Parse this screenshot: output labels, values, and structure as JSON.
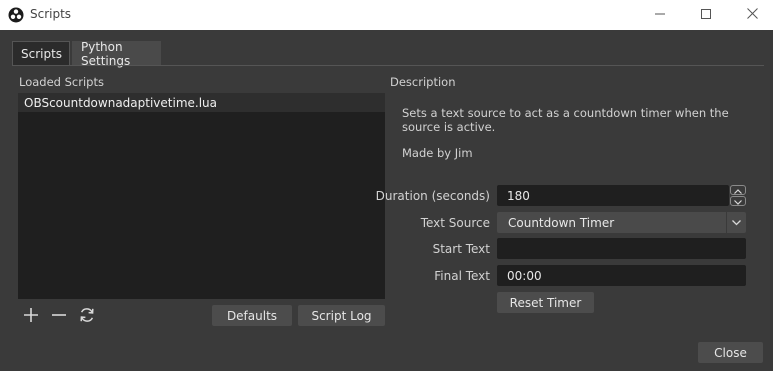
{
  "window": {
    "title": "Scripts",
    "app_icon": "obs-logo-icon"
  },
  "tabs": [
    {
      "label": "Scripts",
      "active": true
    },
    {
      "label": "Python Settings",
      "active": false
    }
  ],
  "loaded_scripts": {
    "label": "Loaded Scripts",
    "items": [
      "OBScountdownadaptivetime.lua"
    ],
    "toolbar_icons": [
      "plus-icon",
      "minus-icon",
      "refresh-icon"
    ],
    "defaults_label": "Defaults",
    "script_log_label": "Script Log"
  },
  "description": {
    "label": "Description",
    "text": "Sets a text source to act as a countdown timer when the source is active.",
    "author": "Made by Jim"
  },
  "settings": {
    "duration": {
      "label": "Duration (seconds)",
      "value": "180"
    },
    "text_source": {
      "label": "Text Source",
      "value": "Countdown Timer"
    },
    "start_text": {
      "label": "Start Text",
      "value": ""
    },
    "final_text": {
      "label": "Final Text",
      "value": "00:00"
    },
    "reset_label": "Reset Timer"
  },
  "close_label": "Close",
  "colors": {
    "background": "#3a3a3a",
    "field": "#1f1f1f",
    "button": "#4c4c4c",
    "titlebar": "#ffffff"
  }
}
